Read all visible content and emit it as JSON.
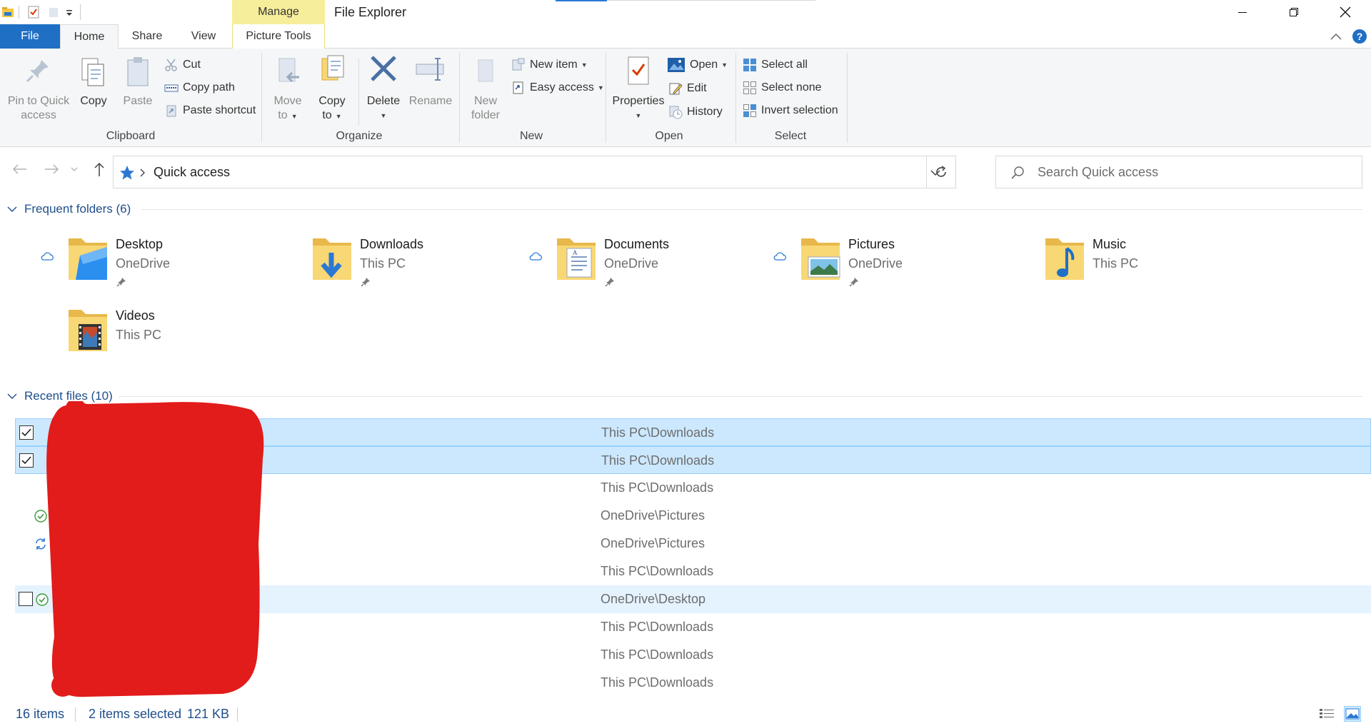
{
  "window": {
    "title": "File Explorer",
    "context_tab_group": "Manage",
    "minimize_icon": "minimize-icon",
    "maximize_icon": "restore-icon",
    "close_icon": "close-icon"
  },
  "ribbon_tabs": {
    "file": "File",
    "home": "Home",
    "share": "Share",
    "view": "View",
    "picture_tools": "Picture Tools"
  },
  "ribbon": {
    "clipboard": {
      "label": "Clipboard",
      "pin_line1": "Pin to Quick",
      "pin_line2": "access",
      "copy": "Copy",
      "paste": "Paste",
      "cut": "Cut",
      "copy_path": "Copy path",
      "paste_shortcut": "Paste shortcut"
    },
    "organize": {
      "label": "Organize",
      "move_line1": "Move",
      "move_line2": "to",
      "copy_line1": "Copy",
      "copy_line2": "to",
      "delete": "Delete",
      "rename": "Rename"
    },
    "new": {
      "label": "New",
      "new_folder_line1": "New",
      "new_folder_line2": "folder",
      "new_item": "New item",
      "easy_access": "Easy access"
    },
    "open": {
      "label": "Open",
      "properties": "Properties",
      "open": "Open",
      "edit": "Edit",
      "history": "History"
    },
    "select": {
      "label": "Select",
      "select_all": "Select all",
      "select_none": "Select none",
      "invert_selection": "Invert selection"
    }
  },
  "address": {
    "location": "Quick access",
    "search_placeholder": "Search Quick access"
  },
  "frequent_folders": {
    "header": "Frequent folders (6)",
    "items": [
      {
        "name": "Desktop",
        "location": "OneDrive"
      },
      {
        "name": "Downloads",
        "location": "This PC"
      },
      {
        "name": "Documents",
        "location": "OneDrive"
      },
      {
        "name": "Pictures",
        "location": "OneDrive"
      },
      {
        "name": "Music",
        "location": "This PC"
      },
      {
        "name": "Videos",
        "location": "This PC"
      }
    ]
  },
  "recent_files": {
    "header": "Recent files (10)",
    "rows": [
      {
        "path": "This PC\\Downloads",
        "state": "selected",
        "checked": true
      },
      {
        "path": "This PC\\Downloads",
        "state": "selected",
        "checked": true
      },
      {
        "path": "This PC\\Downloads",
        "state": "normal"
      },
      {
        "path": "OneDrive\\Pictures",
        "state": "normal",
        "sync": "synced"
      },
      {
        "path": "OneDrive\\Pictures",
        "state": "normal",
        "sync": "syncing"
      },
      {
        "path": "This PC\\Downloads",
        "state": "normal"
      },
      {
        "path": "OneDrive\\Desktop",
        "state": "hover",
        "checked": false,
        "sync": "synced"
      },
      {
        "path": "This PC\\Downloads",
        "state": "normal"
      },
      {
        "path": "This PC\\Downloads",
        "state": "normal"
      },
      {
        "path": "This PC\\Downloads",
        "state": "normal"
      }
    ]
  },
  "status_bar": {
    "item_count": "16 items",
    "selected": "2 items selected",
    "size": "121 KB"
  },
  "colors": {
    "accent": "#1f6fc5",
    "context_tab": "#f6ee9a",
    "selection": "#cce8ff",
    "redaction": "#e21b1b"
  }
}
